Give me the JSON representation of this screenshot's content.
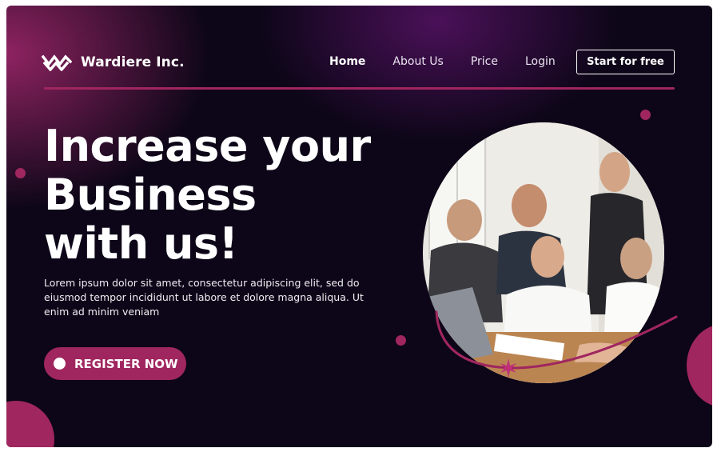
{
  "brand": {
    "name": "Wardiere Inc.",
    "logo_icon": "double-wave-w-logo"
  },
  "nav": {
    "items": [
      "Home",
      "About Us",
      "Price",
      "Login"
    ],
    "active": "Home",
    "cta_label": "Start for free"
  },
  "hero": {
    "headline_lines": [
      "Increase your",
      "Business",
      "with us!"
    ],
    "body": "Lorem ipsum dolor sit amet, consectetur adipiscing elit, sed do eiusmod tempor incididunt ut labore et dolore magna aliqua. Ut enim ad minim veniam",
    "register_label": "REGISTER NOW"
  },
  "photo": {
    "icon": "team-meeting-photo"
  },
  "colors": {
    "accent": "#a0265f",
    "background": "#0d0618",
    "glow_magenta": "#a5286e",
    "glow_purple": "#5f146e",
    "text": "#ffffff"
  }
}
